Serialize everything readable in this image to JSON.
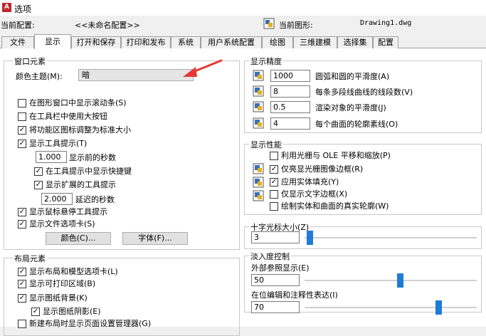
{
  "window": {
    "app_icon_letter": "A",
    "title": "选项"
  },
  "config": {
    "current_config_label": "当前配置:",
    "current_config_value": "<<未命名配置>>",
    "current_drawing_label": "当前图形:",
    "current_drawing_value": "Drawing1.dwg"
  },
  "tabs": [
    "文件",
    "显示",
    "打开和保存",
    "打印和发布",
    "系统",
    "用户系统配置",
    "绘图",
    "三维建模",
    "选择集",
    "配置"
  ],
  "active_tab": "显示",
  "window_elements": {
    "title": "窗口元素",
    "color_theme_label": "颜色主题(M):",
    "color_theme_value": "暗",
    "checkboxes": [
      {
        "label": "在图形窗口中显示滚动条(S)",
        "checked": false
      },
      {
        "label": "在工具栏中使用大按钮",
        "checked": false
      },
      {
        "label": "将功能区图标调整为标准大小",
        "checked": true
      },
      {
        "label": "显示工具提示(T)",
        "checked": true
      }
    ],
    "delay_seconds_value": "1.000",
    "delay_seconds_label": "显示前的秒数",
    "show_shortcut_label": "在工具提示中显示快捷键",
    "show_shortcut_checked": true,
    "show_extended_label": "显示扩展的工具提示",
    "show_extended_checked": true,
    "extended_delay_value": "2.000",
    "extended_delay_label": "延迟的秒数",
    "show_rollover_label": "显示鼠标悬停工具提示",
    "show_rollover_checked": true,
    "show_file_tabs_label": "显示文件选项卡(S)",
    "show_file_tabs_checked": true,
    "colors_button": "颜色(C)...",
    "fonts_button": "字体(F)..."
  },
  "layout_elements": {
    "title": "布局元素",
    "checkboxes": [
      {
        "label": "显示布局和模型选项卡(L)",
        "checked": true
      },
      {
        "label": "显示可打印区域(B)",
        "checked": true
      },
      {
        "label": "显示图纸背景(K)",
        "checked": true
      }
    ],
    "paper_shadow_label": "显示图纸阴影(E)",
    "paper_shadow_checked": true,
    "page_setup_label": "新建布局时显示页面设置管理器(G)",
    "page_setup_checked": false
  },
  "display_resolution": {
    "title": "显示精度",
    "rows": [
      {
        "value": "1000",
        "label": "圆弧和圆的平滑度(A)"
      },
      {
        "value": "8",
        "label": "每条多段线曲线的线段数(V)"
      },
      {
        "value": "0.5",
        "label": "渲染对象的平滑度(J)"
      },
      {
        "value": "4",
        "label": "每个曲面的轮廓素线(O)"
      }
    ]
  },
  "display_performance": {
    "title": "显示性能",
    "checkboxes": [
      {
        "label": "利用光栅与 OLE 平移和缩放(P)",
        "checked": false
      },
      {
        "label": "仅亮显光栅图像边框(R)",
        "checked": true
      },
      {
        "label": "应用实体填充(Y)",
        "checked": true
      },
      {
        "label": "仅显示文字边框(X)",
        "checked": false
      },
      {
        "label": "绘制实体和曲面的真实轮廓(W)",
        "checked": false
      }
    ]
  },
  "crosshair": {
    "title": "十字光标大小(Z)",
    "value": "3",
    "level": 3
  },
  "fade_control": {
    "title": "淡入度控制",
    "xref_label": "外部参照显示(E)",
    "xref_value": "50",
    "inplace_label": "在位编辑和注释性表达(I)",
    "inplace_value": "70",
    "xref_level": 50,
    "inplace_level": 70
  },
  "colors": {
    "accent": "#1e7bd6",
    "arrow": "#e53935",
    "app_icon": "#c1272d",
    "drawing_icon_blue": "#3a6fb5",
    "drawing_icon_yellow": "#e8b020"
  },
  "icons": {
    "app": "autocad-logo-icon",
    "drawing": "drawing-file-icon",
    "resolution": "resolution-icon",
    "performance": "performance-icon",
    "arrow": "red-arrow-icon"
  }
}
